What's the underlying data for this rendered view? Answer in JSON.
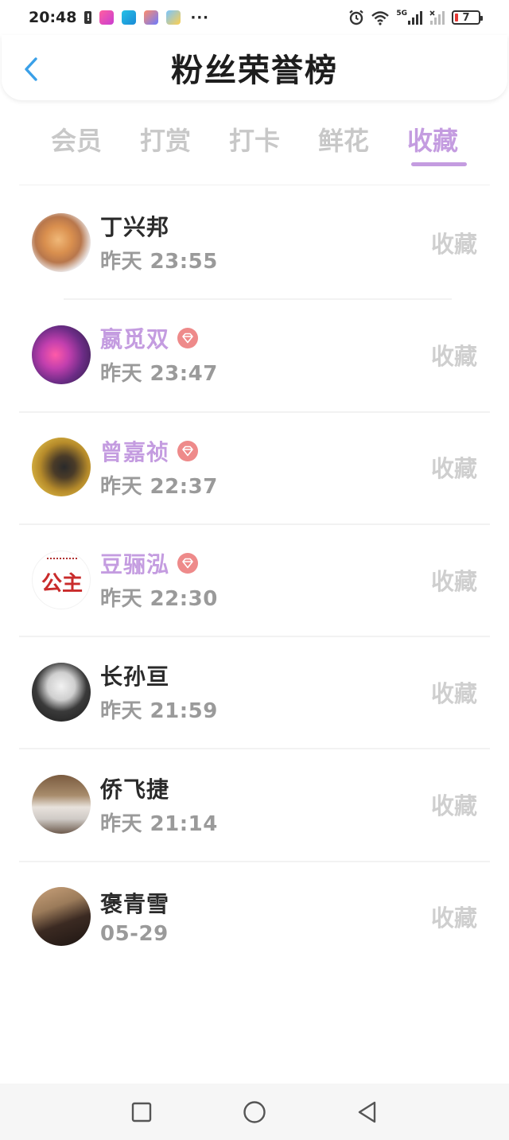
{
  "status_bar": {
    "time": "20:48",
    "signal_label": "5G",
    "battery": "7",
    "icons": [
      "alert-icon",
      "app-icon",
      "book-app-icon",
      "game-app-icon",
      "weather-app-icon",
      "more-dots",
      "alarm-icon",
      "wifi-icon",
      "signal-icon",
      "signal-icon-2",
      "battery-icon"
    ]
  },
  "header": {
    "title": "粉丝荣誉榜",
    "back_icon": "chevron-left-icon"
  },
  "tabs": [
    {
      "label": "会员",
      "active": false
    },
    {
      "label": "打赏",
      "active": false
    },
    {
      "label": "打卡",
      "active": false
    },
    {
      "label": "鲜花",
      "active": false
    },
    {
      "label": "收藏",
      "active": true
    }
  ],
  "list": [
    {
      "name": "丁兴邦",
      "time": "昨天 23:55",
      "action": "收藏",
      "vip": false
    },
    {
      "name": "嬴觅双",
      "time": "昨天 23:47",
      "action": "收藏",
      "vip": true
    },
    {
      "name": "曾嘉祯",
      "time": "昨天 22:37",
      "action": "收藏",
      "vip": true
    },
    {
      "name": "豆骊泓",
      "time": "昨天 22:30",
      "action": "收藏",
      "vip": true
    },
    {
      "name": "长孙亘",
      "time": "昨天 21:59",
      "action": "收藏",
      "vip": false
    },
    {
      "name": "侨飞捷",
      "time": "昨天 21:14",
      "action": "收藏",
      "vip": false
    },
    {
      "name": "褒青雪",
      "time": "05-29",
      "action": "收藏",
      "vip": false
    }
  ],
  "avatar_stamp_text": "公主",
  "colors": {
    "accent": "#c49ce0",
    "vip_badge": "#ee8a8a",
    "muted": "#9a9a9a",
    "action": "#cfcfcf"
  },
  "bottom_nav": [
    "square-icon",
    "circle-home-icon",
    "triangle-back-icon"
  ]
}
